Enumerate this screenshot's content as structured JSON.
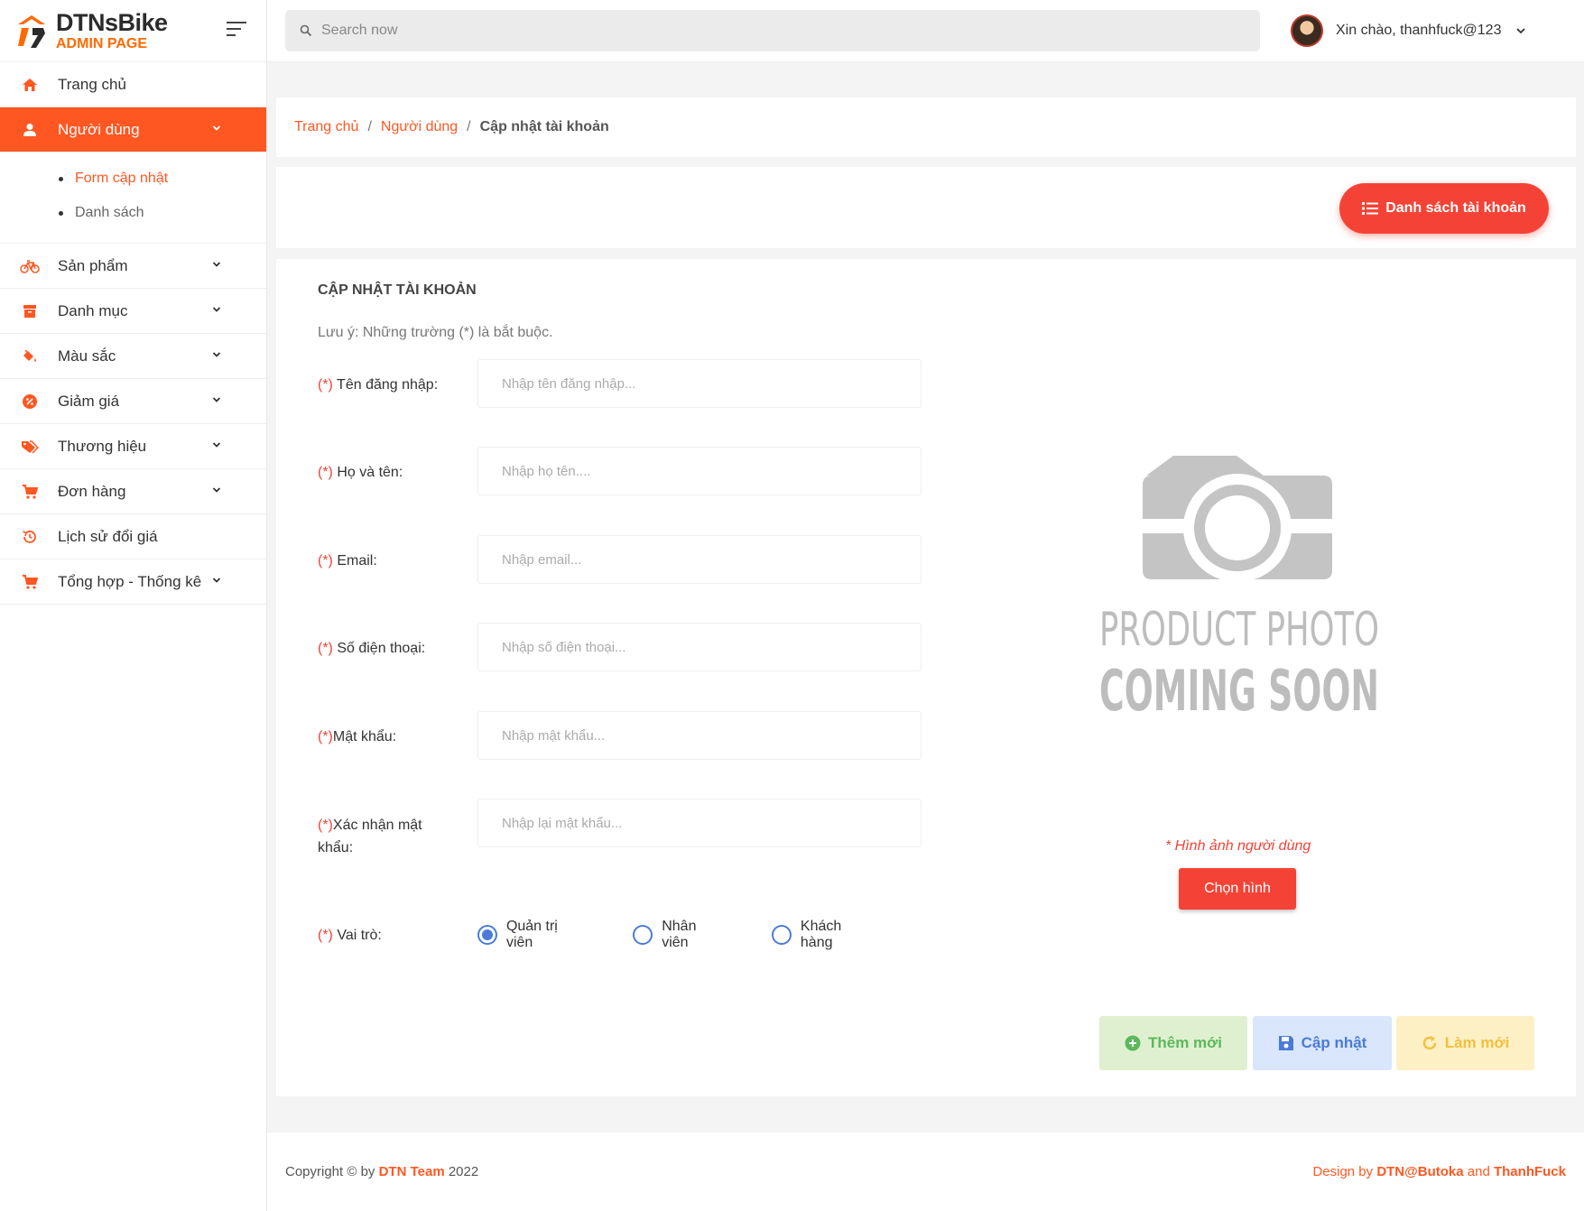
{
  "brand": {
    "name": "DTNsBike",
    "subtitle": "ADMIN PAGE"
  },
  "sidebar": {
    "items": [
      {
        "label": "Trang chủ",
        "icon": "home-icon"
      },
      {
        "label": "Người dùng",
        "icon": "user-icon",
        "active": true,
        "children": [
          {
            "label": "Form cập nhật",
            "active": true
          },
          {
            "label": "Danh sách"
          }
        ]
      },
      {
        "label": "Sản phẩm",
        "icon": "bicycle-icon"
      },
      {
        "label": "Danh mục",
        "icon": "archive-icon"
      },
      {
        "label": "Màu sắc",
        "icon": "paint-bucket-icon"
      },
      {
        "label": "Giảm giá",
        "icon": "discount-badge-icon"
      },
      {
        "label": "Thương hiệu",
        "icon": "tags-icon"
      },
      {
        "label": "Đơn hàng",
        "icon": "cart-icon"
      },
      {
        "label": "Lịch sử đổi giá",
        "icon": "history-icon"
      },
      {
        "label": "Tổng hợp - Thống kê",
        "icon": "cart-icon"
      }
    ]
  },
  "topbar": {
    "search_placeholder": "Search now",
    "greeting": "Xin chào, thanhfuck@123"
  },
  "breadcrumb": {
    "home": "Trang chủ",
    "section": "Người dùng",
    "current": "Cập nhật tài khoản"
  },
  "actions": {
    "list_button": "Danh sách tài khoản"
  },
  "form": {
    "title": "CẬP NHẬT TÀI KHOẢN",
    "note": "Lưu ý: Những trường (*) là bắt buộc.",
    "required_mark": "(*)",
    "fields": {
      "username": {
        "label": " Tên đăng nhập:",
        "placeholder": "Nhập tên đăng nhập..."
      },
      "fullname": {
        "label": " Họ và tên:",
        "placeholder": "Nhập họ tên...."
      },
      "email": {
        "label": " Email:",
        "placeholder": "Nhập email..."
      },
      "phone": {
        "label": " Số điện thoại:",
        "placeholder": "Nhập số điện thoại..."
      },
      "password": {
        "label": "Mật khẩu:",
        "placeholder": "Nhập mật khẩu..."
      },
      "confirm": {
        "label": "Xác nhận mật khẩu:",
        "placeholder": "Nhập lại mật khẩu..."
      },
      "role": {
        "label": " Vai trò:",
        "options": [
          "Quản trị viên",
          "Nhân viên",
          "Khách hàng"
        ],
        "selected": "Quản trị viên"
      }
    },
    "photo": {
      "line1": "PRODUCT PHOTO",
      "line2": "COMING SOON",
      "caption": "* Hình ảnh người dùng",
      "choose_button": "Chọn hình"
    },
    "buttons": {
      "add": "Thêm mới",
      "update": "Cập nhật",
      "reset": "Làm mới"
    }
  },
  "footer": {
    "copyright_prefix": "Copyright © by ",
    "team": "DTN Team",
    "year": " 2022",
    "design_prefix": "Design by ",
    "designer1": "DTN@Butoka",
    "and": " and ",
    "designer2": "ThanhFuck"
  },
  "colors": {
    "accent": "#ff5722",
    "danger": "#f44336",
    "radio": "#4a7bd8"
  }
}
